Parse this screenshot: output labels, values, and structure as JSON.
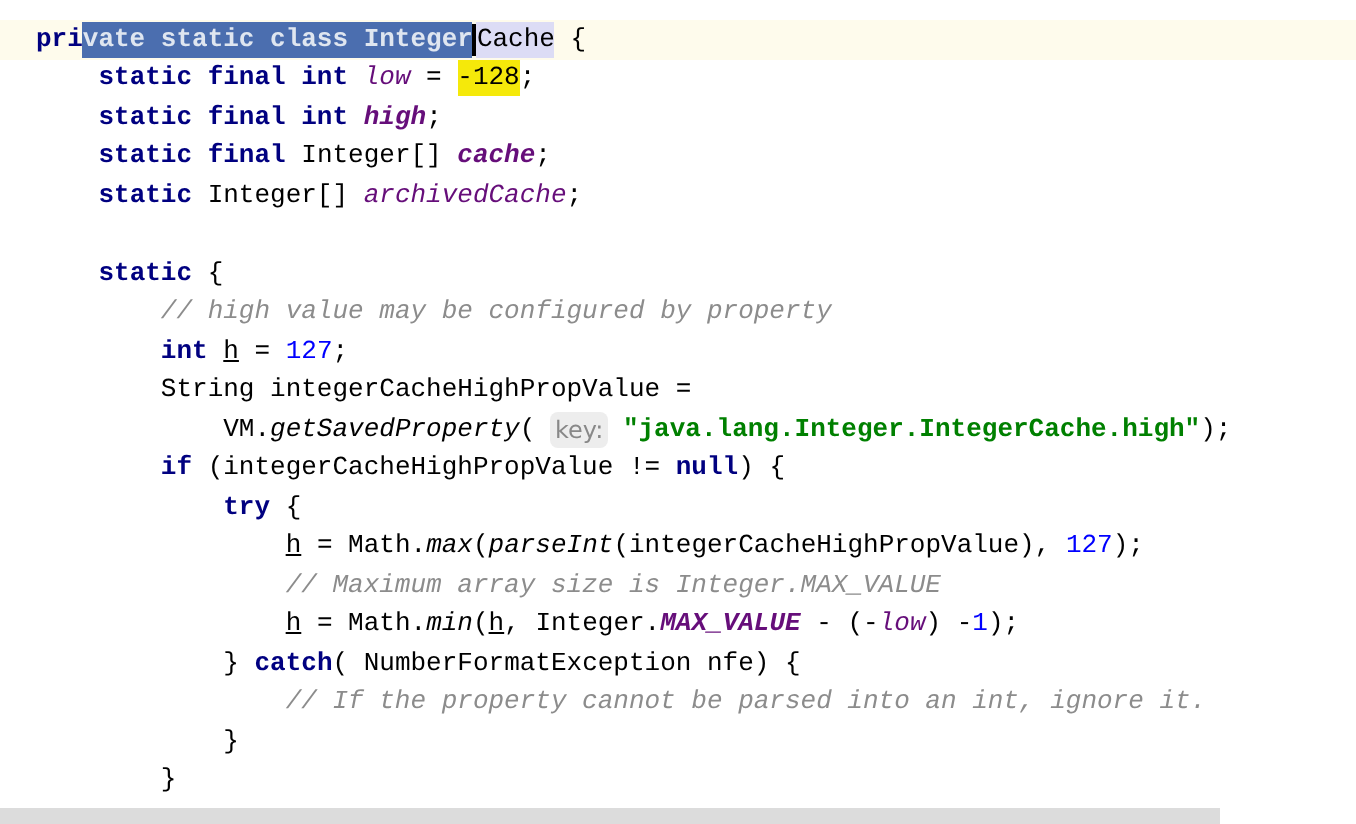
{
  "editor": {
    "lines": [
      {
        "kind": "code",
        "current": true,
        "tokens": [
          {
            "kind": "keyword",
            "text": "pri"
          },
          {
            "kind": "selection",
            "text": "vate static class Integer"
          },
          {
            "kind": "usage",
            "text": "Cache",
            "caret": true
          },
          {
            "kind": "plain",
            "text": " {"
          }
        ]
      },
      {
        "kind": "code",
        "current": false,
        "tokens": [
          {
            "kind": "keyword",
            "text": "    static final int "
          },
          {
            "kind": "field",
            "text": "low"
          },
          {
            "kind": "plain",
            "text": " = "
          },
          {
            "kind": "match",
            "text": "-128"
          },
          {
            "kind": "plain",
            "text": ";"
          }
        ]
      },
      {
        "kind": "code",
        "current": false,
        "tokens": [
          {
            "kind": "keyword",
            "text": "    static final int "
          },
          {
            "kind": "field_bold",
            "text": "high"
          },
          {
            "kind": "plain",
            "text": ";"
          }
        ]
      },
      {
        "kind": "code",
        "current": false,
        "tokens": [
          {
            "kind": "keyword",
            "text": "    static final "
          },
          {
            "kind": "plain",
            "text": "Integer[] "
          },
          {
            "kind": "field_bold",
            "text": "cache"
          },
          {
            "kind": "plain",
            "text": ";"
          }
        ]
      },
      {
        "kind": "code",
        "current": false,
        "tokens": [
          {
            "kind": "keyword",
            "text": "    static "
          },
          {
            "kind": "plain",
            "text": "Integer[] "
          },
          {
            "kind": "field",
            "text": "archivedCache"
          },
          {
            "kind": "plain",
            "text": ";"
          }
        ]
      },
      {
        "kind": "blank",
        "current": false
      },
      {
        "kind": "code",
        "current": false,
        "tokens": [
          {
            "kind": "keyword",
            "text": "    static "
          },
          {
            "kind": "plain",
            "text": "{"
          }
        ]
      },
      {
        "kind": "code",
        "current": false,
        "tokens": [
          {
            "kind": "comment",
            "text": "        // high value may be configured by property"
          }
        ]
      },
      {
        "kind": "code",
        "current": false,
        "tokens": [
          {
            "kind": "keyword",
            "text": "        int "
          },
          {
            "kind": "var",
            "text": "h"
          },
          {
            "kind": "plain",
            "text": " = "
          },
          {
            "kind": "number",
            "text": "127"
          },
          {
            "kind": "plain",
            "text": ";"
          }
        ]
      },
      {
        "kind": "code",
        "current": false,
        "tokens": [
          {
            "kind": "plain",
            "text": "        String integerCacheHighPropValue ="
          }
        ]
      },
      {
        "kind": "code",
        "current": false,
        "tokens": [
          {
            "kind": "plain",
            "text": "            VM."
          },
          {
            "kind": "static_method",
            "text": "getSavedProperty"
          },
          {
            "kind": "plain",
            "text": "( "
          },
          {
            "kind": "hint",
            "text": "key:"
          },
          {
            "kind": "string",
            "text": " \"java.lang.Integer.IntegerCache.high\""
          },
          {
            "kind": "plain",
            "text": ");"
          }
        ]
      },
      {
        "kind": "code",
        "current": false,
        "tokens": [
          {
            "kind": "keyword",
            "text": "        if "
          },
          {
            "kind": "plain",
            "text": "(integerCacheHighPropValue != "
          },
          {
            "kind": "keyword",
            "text": "null"
          },
          {
            "kind": "plain",
            "text": ") {"
          }
        ]
      },
      {
        "kind": "code",
        "current": false,
        "tokens": [
          {
            "kind": "keyword",
            "text": "            try "
          },
          {
            "kind": "plain",
            "text": "{"
          }
        ]
      },
      {
        "kind": "code",
        "current": false,
        "tokens": [
          {
            "kind": "var",
            "text": "                h"
          },
          {
            "kind": "plain",
            "text": " = Math."
          },
          {
            "kind": "static_method",
            "text": "max"
          },
          {
            "kind": "plain",
            "text": "("
          },
          {
            "kind": "static_method",
            "text": "parseInt"
          },
          {
            "kind": "plain",
            "text": "(integerCacheHighPropValue), "
          },
          {
            "kind": "number",
            "text": "127"
          },
          {
            "kind": "plain",
            "text": ");"
          }
        ]
      },
      {
        "kind": "code",
        "current": false,
        "tokens": [
          {
            "kind": "comment",
            "text": "                // Maximum array size is Integer.MAX_VALUE"
          }
        ]
      },
      {
        "kind": "code",
        "current": false,
        "tokens": [
          {
            "kind": "var",
            "text": "                h"
          },
          {
            "kind": "plain",
            "text": " = Math."
          },
          {
            "kind": "static_method",
            "text": "min"
          },
          {
            "kind": "plain",
            "text": "("
          },
          {
            "kind": "var",
            "text": "h"
          },
          {
            "kind": "plain",
            "text": ", Integer."
          },
          {
            "kind": "field_bold",
            "text": "MAX_VALUE"
          },
          {
            "kind": "plain",
            "text": " - (-"
          },
          {
            "kind": "field",
            "text": "low"
          },
          {
            "kind": "plain",
            "text": ") -"
          },
          {
            "kind": "number",
            "text": "1"
          },
          {
            "kind": "plain",
            "text": ");"
          }
        ]
      },
      {
        "kind": "code",
        "current": false,
        "tokens": [
          {
            "kind": "plain",
            "text": "            } "
          },
          {
            "kind": "keyword",
            "text": "catch"
          },
          {
            "kind": "plain",
            "text": "( NumberFormatException nfe) {"
          }
        ]
      },
      {
        "kind": "code",
        "current": false,
        "tokens": [
          {
            "kind": "comment",
            "text": "                // If the property cannot be parsed into an int, ignore it."
          }
        ]
      },
      {
        "kind": "code",
        "current": false,
        "tokens": [
          {
            "kind": "plain",
            "text": "            }"
          }
        ]
      },
      {
        "kind": "code",
        "current": false,
        "tokens": [
          {
            "kind": "plain",
            "text": "        }"
          }
        ]
      }
    ]
  }
}
